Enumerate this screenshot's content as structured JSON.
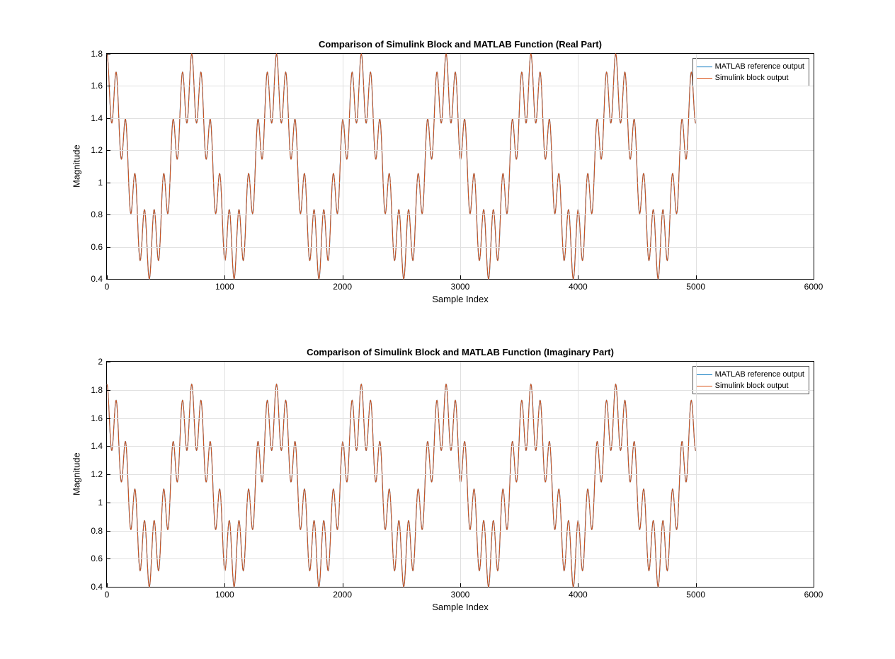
{
  "chart_data": [
    {
      "type": "line",
      "title": "Comparison of Simulink Block and MATLAB Function (Real Part)",
      "xlabel": "Sample Index",
      "ylabel": "Magnitude",
      "xlim": [
        0,
        6000
      ],
      "ylim": [
        0.4,
        1.8
      ],
      "xticks": [
        0,
        1000,
        2000,
        3000,
        4000,
        5000,
        6000
      ],
      "yticks": [
        0.4,
        0.6,
        0.8,
        1.0,
        1.2,
        1.4,
        1.6,
        1.8
      ],
      "legend_position": "top-right",
      "grid": true,
      "n_points": 5001,
      "period": 720,
      "series": [
        {
          "name": "MATLAB reference output",
          "color": "#0072bd",
          "formula": "1.1 + 0.5*cos(2*pi*x/720) + 0.20*cos(2*pi*x/80)",
          "components": {
            "offset": 1.1,
            "slow_amp": 0.5,
            "slow_period": 720,
            "fast_amp": 0.2,
            "fast_period": 80
          }
        },
        {
          "name": "Simulink block output",
          "color": "#d95319",
          "formula": "1.1 + 0.5*cos(2*pi*x/720) + 0.20*cos(2*pi*x/80)",
          "components": {
            "offset": 1.1,
            "slow_amp": 0.5,
            "slow_period": 720,
            "fast_amp": 0.2,
            "fast_period": 80
          }
        }
      ]
    },
    {
      "type": "line",
      "title": "Comparison of Simulink Block and MATLAB Function (Imaginary Part)",
      "xlabel": "Sample Index",
      "ylabel": "Magnitude",
      "xlim": [
        0,
        6000
      ],
      "ylim": [
        0.4,
        2.0
      ],
      "xticks": [
        0,
        1000,
        2000,
        3000,
        4000,
        5000,
        6000
      ],
      "yticks": [
        0.4,
        0.6,
        0.8,
        1.0,
        1.2,
        1.4,
        1.6,
        1.8,
        2.0
      ],
      "legend_position": "top-right",
      "grid": true,
      "n_points": 5001,
      "period": 720,
      "series": [
        {
          "name": "MATLAB reference output",
          "color": "#0072bd",
          "formula": "1.12 + 0.5*cos(2*pi*x/720) + 0.22*cos(2*pi*x/80)",
          "components": {
            "offset": 1.12,
            "slow_amp": 0.5,
            "slow_period": 720,
            "fast_amp": 0.22,
            "fast_period": 80
          }
        },
        {
          "name": "Simulink block output",
          "color": "#d95319",
          "formula": "1.12 + 0.5*cos(2*pi*x/720) + 0.22*cos(2*pi*x/80)",
          "components": {
            "offset": 1.12,
            "slow_amp": 0.5,
            "slow_period": 720,
            "fast_amp": 0.22,
            "fast_period": 80
          }
        }
      ]
    }
  ]
}
